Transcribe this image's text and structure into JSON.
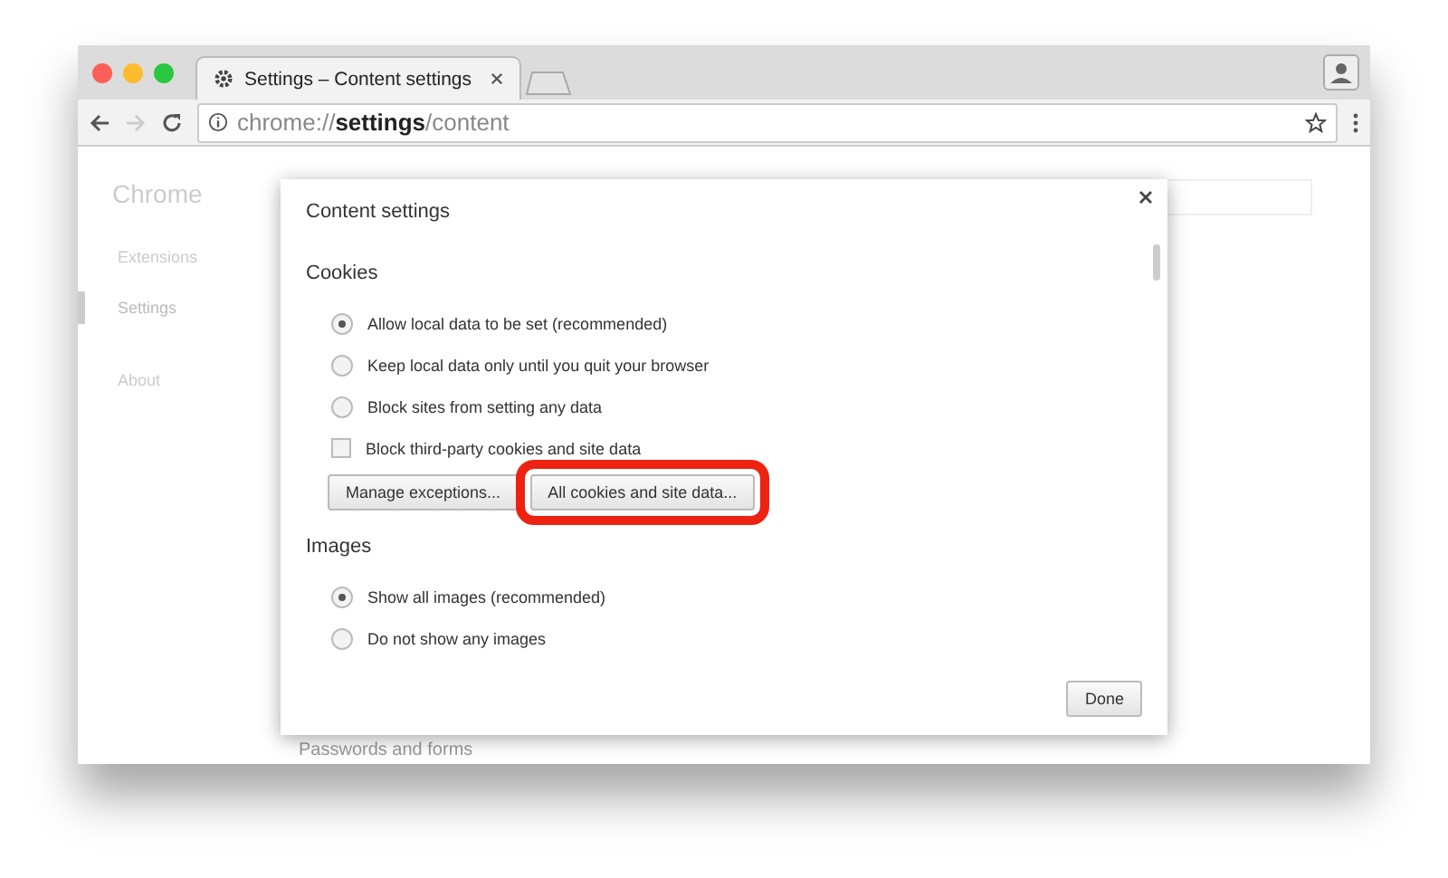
{
  "tabs": [
    {
      "title": "Settings – Content settings",
      "selected": true
    }
  ],
  "address": {
    "scheme": "chrome://",
    "host": "settings",
    "path": "/content"
  },
  "sidebar": {
    "title": "Chrome",
    "items": [
      {
        "label": "Extensions",
        "selected": false
      },
      {
        "label": "Settings",
        "selected": true
      },
      {
        "label": "About",
        "selected": false
      }
    ]
  },
  "background_section": "Passwords and forms",
  "dialog": {
    "title": "Content settings",
    "sections": [
      {
        "heading": "Cookies",
        "options": [
          {
            "kind": "radio",
            "label": "Allow local data to be set (recommended)",
            "checked": true
          },
          {
            "kind": "radio",
            "label": "Keep local data only until you quit your browser",
            "checked": false
          },
          {
            "kind": "radio",
            "label": "Block sites from setting any data",
            "checked": false
          },
          {
            "kind": "checkbox",
            "label": "Block third-party cookies and site data",
            "checked": false
          }
        ],
        "buttons": [
          {
            "label": "Manage exceptions...",
            "highlighted": false
          },
          {
            "label": "All cookies and site data...",
            "highlighted": true
          }
        ]
      },
      {
        "heading": "Images",
        "options": [
          {
            "kind": "radio",
            "label": "Show all images (recommended)",
            "checked": true
          },
          {
            "kind": "radio",
            "label": "Do not show any images",
            "checked": false
          }
        ]
      }
    ],
    "done_button": "Done"
  }
}
